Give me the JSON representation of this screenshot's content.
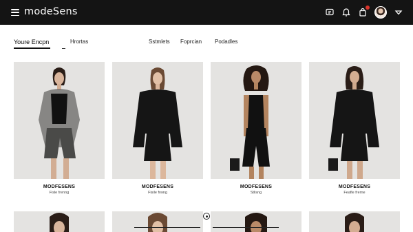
{
  "header": {
    "logo": "modeSens",
    "icons": [
      "menu-icon",
      "chat-icon",
      "bell-icon",
      "bag-icon",
      "avatar",
      "chevron-down-icon"
    ],
    "accent": "#d9342b",
    "bar_color": "#141414"
  },
  "subnav": {
    "items": [
      {
        "label": "Youre Encpn",
        "active": true
      },
      {
        "label": "Hrortas",
        "active": false
      },
      {
        "label": "Sstmlets",
        "active": false
      },
      {
        "label": "Foprcian",
        "active": false
      },
      {
        "label": "Podadles",
        "active": false
      }
    ]
  },
  "products": [
    {
      "brand": "MODFESENS",
      "name": "Fisle frenng"
    },
    {
      "brand": "MODFESENS",
      "name": "Fisile frwng"
    },
    {
      "brand": "MODFESENS",
      "name": "Stlisng"
    },
    {
      "brand": "MODFESENS",
      "name": "Feafle frerne"
    }
  ],
  "brand_display": [
    "MODFESENS",
    "MODFESENS",
    "MODFESENS",
    "MODFESENS"
  ]
}
